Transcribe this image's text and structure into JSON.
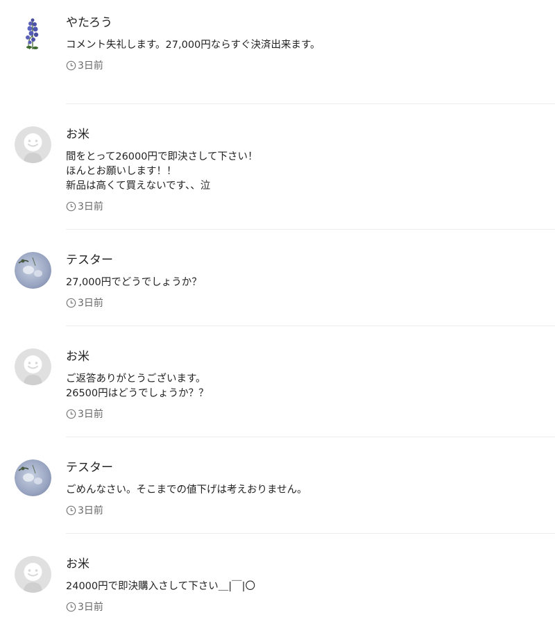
{
  "comments": [
    {
      "name": "やたろう",
      "avatar": "flower-avatar",
      "text": "コメント失礼します。27,000円ならすぐ決済出来ます。",
      "time": "3日前"
    },
    {
      "name": "お米",
      "avatar": "default-user-avatar",
      "text": "間をとって26000円で即決さして下さい！\nほんとお願いします！！\n新品は高くて買えないです、、泣",
      "time": "3日前"
    },
    {
      "name": "テスター",
      "avatar": "photo-avatar",
      "text": "27,000円でどうでしょうか？",
      "time": "3日前"
    },
    {
      "name": "お米",
      "avatar": "default-user-avatar",
      "text": "ご返答ありがとうございます。\n26500円はどうでしょうか？？",
      "time": "3日前"
    },
    {
      "name": "テスター",
      "avatar": "photo-avatar",
      "text": "ごめんなさい。そこまでの値下げは考えおりません。",
      "time": "3日前"
    },
    {
      "name": "お米",
      "avatar": "default-user-avatar",
      "text": "24000円で即決購入さして下さい＿|￣|〇",
      "time": "3日前"
    }
  ],
  "colors": {
    "text": "#222222",
    "meta": "#666666",
    "divider": "#ececec",
    "default_avatar_bg": "#e0e0e0",
    "default_avatar_fg": "#ffffff"
  },
  "icons": {
    "time": "clock-icon"
  }
}
